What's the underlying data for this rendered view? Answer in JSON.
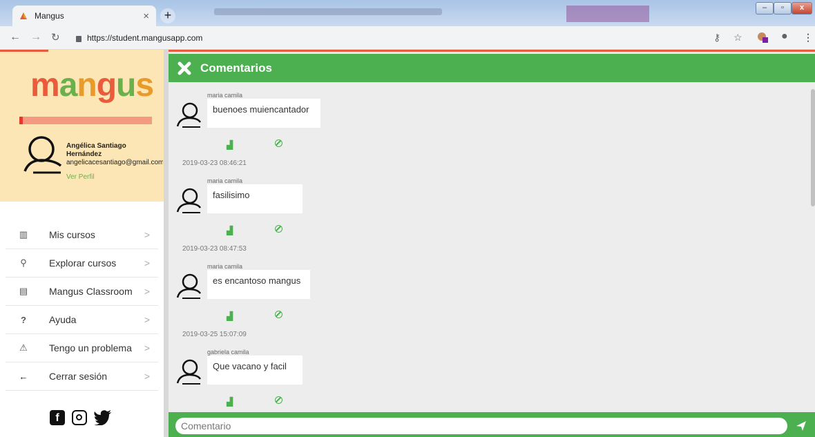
{
  "browser": {
    "tab_title": "Mangus",
    "tab_close": "×",
    "new_tab": "+",
    "url": "https://student.mangusapp.com",
    "extension_badge": "1"
  },
  "sidebar": {
    "logo_letters": [
      "m",
      "a",
      "n",
      "g",
      "u",
      "s"
    ],
    "user": {
      "name": "Angélica Santiago Hernández",
      "email": "angelicacesantiago@gmail.com",
      "profile_link": "Ver Perfil"
    },
    "menu": [
      {
        "label": "Mis cursos",
        "icon": "book-icon"
      },
      {
        "label": "Explorar cursos",
        "icon": "search-icon"
      },
      {
        "label": "Mangus Classroom",
        "icon": "presentation-icon"
      },
      {
        "label": "Ayuda",
        "icon": "help-icon"
      },
      {
        "label": "Tengo un problema",
        "icon": "warning-icon"
      },
      {
        "label": "Cerrar sesión",
        "icon": "arrow-left-icon"
      }
    ],
    "social": [
      "facebook-icon",
      "instagram-icon",
      "twitter-icon"
    ]
  },
  "main": {
    "title": "Comentarios",
    "comments": [
      {
        "author": "maria camila",
        "text": "buenoes muiencantador",
        "date": "2019-03-23 08:46:21"
      },
      {
        "author": "maria camila",
        "text": "fasilisimo",
        "date": "2019-03-23 08:47:53"
      },
      {
        "author": "maria camila",
        "text": "es encantoso mangus",
        "date": "2019-03-25 15:07:09"
      },
      {
        "author": "gabriela camila",
        "text": "Que vacano y facil",
        "date": ""
      }
    ],
    "composer_placeholder": "Comentario"
  },
  "colors": {
    "brand_green": "#4caf50",
    "brand_orange": "#e85b3c",
    "sidebar_header_bg": "#fde6b5"
  }
}
